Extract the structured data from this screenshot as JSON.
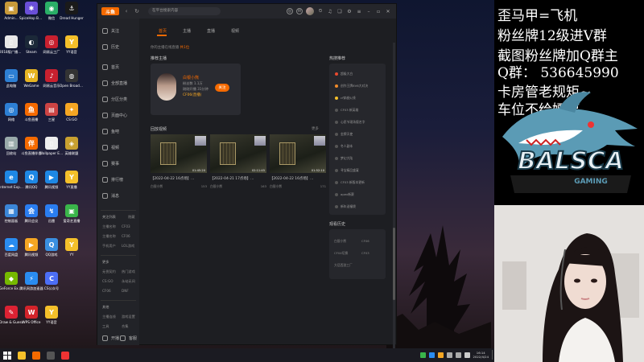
{
  "desktop": {
    "icons": [
      {
        "label": "Admin...",
        "color": "#c89a3a",
        "glyph": "▣"
      },
      {
        "label": "2018版广播电视编辑...",
        "color": "#e8e8e8",
        "glyph": "▯"
      },
      {
        "label": "此电脑",
        "color": "#2d7fd4",
        "glyph": "▭"
      },
      {
        "label": "网络",
        "color": "#2d7fd4",
        "glyph": "◎"
      },
      {
        "label": "回收站",
        "color": "#9aa",
        "glyph": "▥"
      },
      {
        "label": "Internet Explorer",
        "color": "#1e88e5",
        "glyph": "e"
      },
      {
        "label": "控制面板",
        "color": "#3b86d8",
        "glyph": "▦"
      },
      {
        "label": "百度网盘",
        "color": "#2a8cf0",
        "glyph": "☁"
      },
      {
        "label": "GeForce Experience",
        "color": "#76b900",
        "glyph": "◆"
      },
      {
        "label": "Draw & Guess",
        "color": "#d23",
        "glyph": "✎"
      },
      {
        "label": "SpiceHop Business",
        "color": "#6a4fd8",
        "glyph": "✱"
      },
      {
        "label": "Steam",
        "color": "#1b2838",
        "glyph": "◐"
      },
      {
        "label": "WeGame",
        "color": "#e6b422",
        "glyph": "W"
      },
      {
        "label": "斗鱼直播",
        "color": "#f56a00",
        "glyph": "鱼"
      },
      {
        "label": "斗鱼直播伴侣",
        "color": "#f56a00",
        "glyph": "伴"
      },
      {
        "label": "腾讯QQ",
        "color": "#1e88e5",
        "glyph": "Q"
      },
      {
        "label": "腾讯会议",
        "color": "#2a7df0",
        "glyph": "会"
      },
      {
        "label": "腾讯视频",
        "color": "#f5a623",
        "glyph": "▶"
      },
      {
        "label": "腾讯网游加速器",
        "color": "#2a8cf0",
        "glyph": "⚡"
      },
      {
        "label": "WPS Office",
        "color": "#d3232a",
        "glyph": "W"
      },
      {
        "label": "微信",
        "color": "#2aae67",
        "glyph": "◉"
      },
      {
        "label": "网易云工厂",
        "color": "#c8202f",
        "glyph": "◎"
      },
      {
        "label": "网易云音乐",
        "color": "#c8202f",
        "glyph": "♪"
      },
      {
        "label": "三星",
        "color": "#c44",
        "glyph": "▤"
      },
      {
        "label": "Wallpaper Engine",
        "color": "#eee",
        "glyph": "▯"
      },
      {
        "label": "腾讯视频",
        "color": "#1e88e5",
        "glyph": "▶"
      },
      {
        "label": "迅雷",
        "color": "#2a7df0",
        "glyph": "↯"
      },
      {
        "label": "QQ游戏",
        "color": "#3a8fe0",
        "glyph": "Q"
      },
      {
        "label": "CS公众号",
        "color": "#4c6ef5",
        "glyph": "C"
      },
      {
        "label": "YY语音",
        "color": "#f5c02a",
        "glyph": "Y"
      },
      {
        "label": "Dread Hunger",
        "color": "#1a1a1a",
        "glyph": "⚓"
      },
      {
        "label": "YY语音",
        "color": "#f5c02a",
        "glyph": "Y"
      },
      {
        "label": "Open Broadcast...",
        "color": "#333",
        "glyph": "◍"
      },
      {
        "label": "CS:GO",
        "color": "#f5a623",
        "glyph": "✦"
      },
      {
        "label": "英雄联盟",
        "color": "#c8a030",
        "glyph": "◈"
      },
      {
        "label": "YY直播",
        "color": "#f5c02a",
        "glyph": "Y"
      },
      {
        "label": "爱奇艺直播",
        "color": "#3ab54a",
        "glyph": "▣"
      },
      {
        "label": "YY",
        "color": "#f5c02a",
        "glyph": "Y"
      }
    ]
  },
  "app": {
    "title_placeholder": "在平台搜索内容",
    "tabs": [
      "首页",
      "主播",
      "直播",
      "视频"
    ],
    "sidebar": {
      "top_label": "关注",
      "items": [
        "历史",
        "首页",
        "全部直播",
        "分区分类",
        "页面中心",
        "鱼吧",
        "视频",
        "赛事",
        "排行榜",
        "消息"
      ],
      "section_follow": "关注列表",
      "section_follow_action": "隐藏",
      "follow_rows": [
        [
          "主播名称",
          "CF03"
        ],
        [
          "主播名称",
          "CF06"
        ],
        [
          "手机用户",
          "LOL游戏"
        ]
      ],
      "section_more": "更多",
      "more_rows": [
        [
          "无畏契约",
          "热门游戏"
        ],
        [
          "CS:GO",
          "永劫无间"
        ],
        [
          "CF06",
          "DNF"
        ]
      ],
      "section_misc": "其他",
      "misc_rows": [
        [
          "主播连线",
          "游戏设置"
        ],
        [
          "工具",
          "合集"
        ]
      ],
      "bottom": [
        "开播",
        "客服"
      ]
    },
    "notice_prefix": "你的主播在线直播",
    "notice_hl": "共1位",
    "follow_title": "推荐主播",
    "streamer": {
      "name": "白银小熊",
      "meta1": "粉丝数 1.1万",
      "meta2": "刚刚开播 31分钟",
      "live": "CF06(直播)",
      "follow_btn": "关注"
    },
    "video_title": "回放视频",
    "video_more": "更多",
    "videos": [
      {
        "title": "【2022-04-22 16点场】...",
        "author": "白银小熊",
        "views": "153",
        "dur": "01:45:20"
      },
      {
        "title": "【2022-04-21 17点场】...",
        "author": "白银小熊",
        "views": "163",
        "dur": "02:11:45"
      },
      {
        "title": "【2022-04-22 16点场】...",
        "author": "白银小熊",
        "views": "171",
        "dur": "01:52:10"
      }
    ],
    "hot_title": "热搜推荐",
    "hot_items": [
      "超级大白",
      "创作王牌6V6大对决",
      "cf穿越火线",
      "CF03 新英雄",
      "心愿节现场版名字",
      "金牌天使",
      "冬人副本",
      "梦幻大陆",
      "寻宝精品盛宴",
      "CF03 新版本更新",
      "apex新赛",
      "新年送福袋"
    ],
    "history_title": "观看历史",
    "history_rows": [
      [
        "白银小熊",
        "CF06"
      ],
      [
        "CF04切换",
        "CF03"
      ],
      [
        "大话西游工厂",
        ""
      ]
    ]
  },
  "overlay": {
    "lines": [
      "歪马甲=飞机",
      "粉丝牌12级进V群",
      "截图粉丝牌加Q群主",
      "Q群：  536645990",
      "卡房管老规矩~",
      "车位不给嫖哼"
    ],
    "logo_text": "BALSCA",
    "logo_sub": "GAMING"
  },
  "taskbar": {
    "time": "16:14",
    "date": "2022/4/24"
  }
}
